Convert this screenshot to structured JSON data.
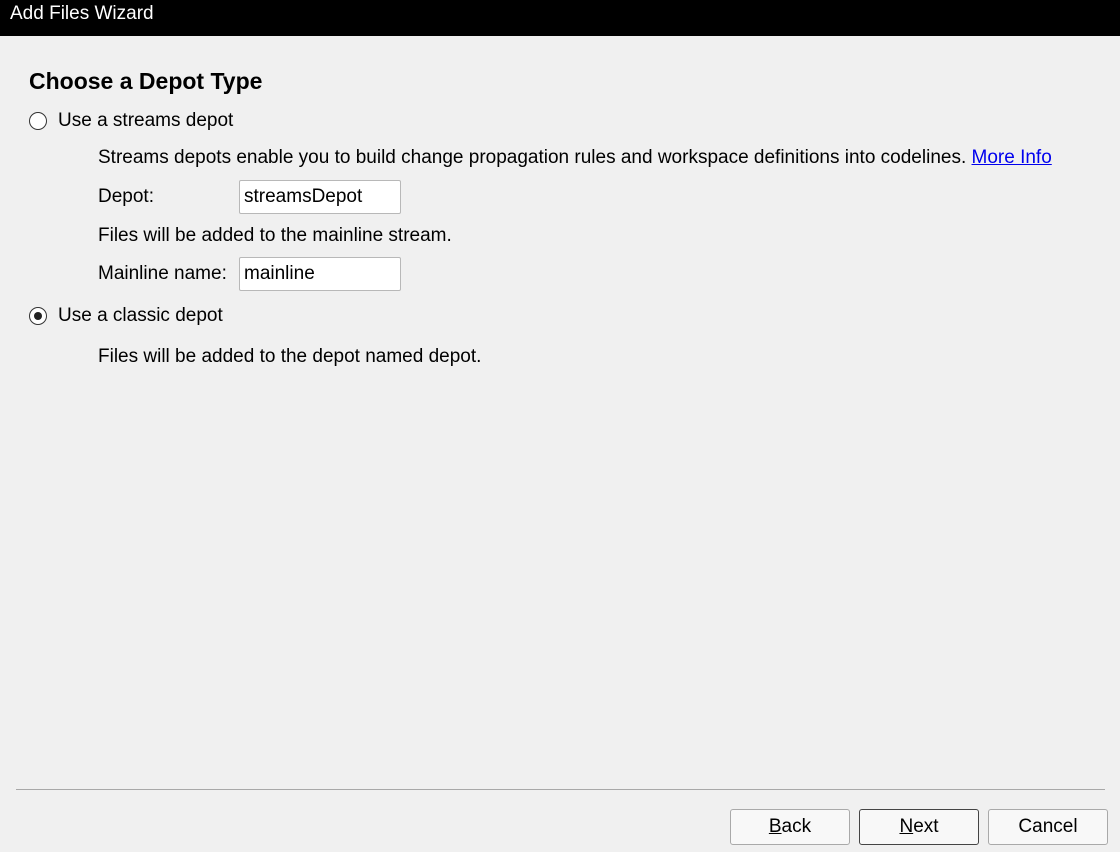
{
  "window": {
    "title": "Add Files Wizard"
  },
  "page": {
    "heading": "Choose a Depot Type"
  },
  "streams_option": {
    "label": "Use a streams depot",
    "selected": false,
    "description": "Streams depots enable you to build change propagation rules and workspace definitions into codelines.",
    "more_info_link": "More Info",
    "depot_label": "Depot:",
    "depot_value": "streamsDepot",
    "mainline_note": "Files will be added to the mainline stream.",
    "mainline_label": "Mainline name:",
    "mainline_value": "mainline"
  },
  "classic_option": {
    "label": "Use a classic depot",
    "selected": true,
    "note": "Files will be added to the depot named depot."
  },
  "buttons": {
    "back": {
      "mnemonic": "B",
      "rest": "ack"
    },
    "next": {
      "mnemonic": "N",
      "rest": "ext"
    },
    "cancel": "Cancel"
  }
}
